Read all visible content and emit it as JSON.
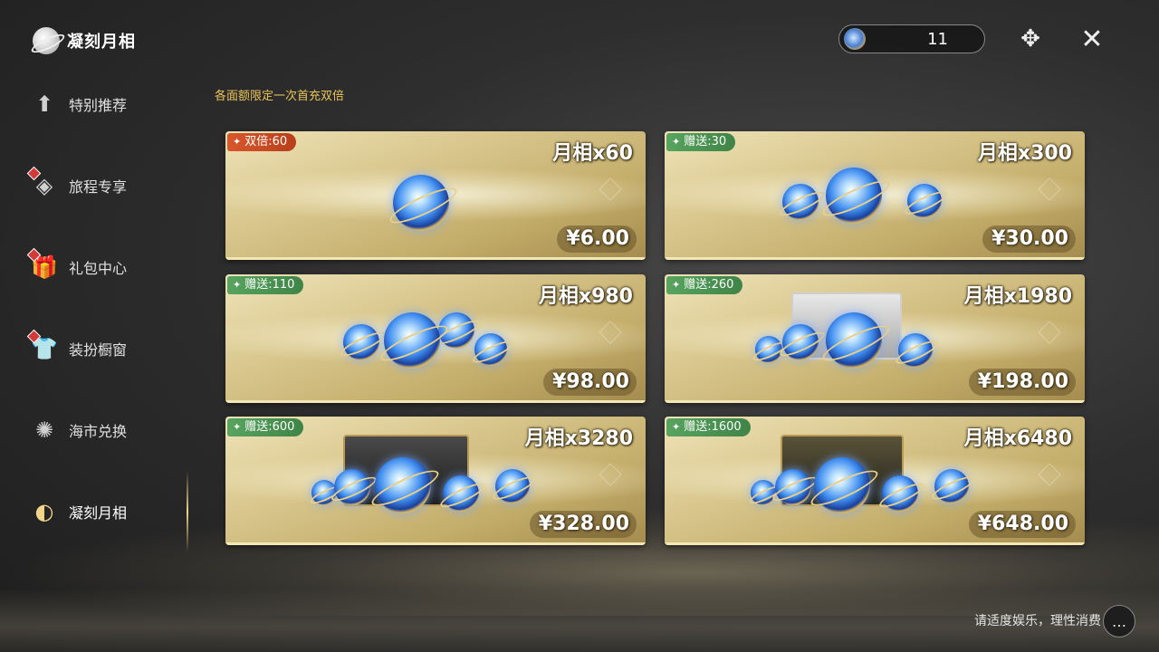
{
  "header": {
    "title": "凝刻月相",
    "currency_amount": "11"
  },
  "icons": {
    "close": "✕",
    "guide": "✥",
    "chat": "…"
  },
  "sidebar": {
    "items": [
      {
        "label": "特别推荐",
        "icon": "gift-arrow-icon",
        "glyph": "⬆",
        "badge": false
      },
      {
        "label": "旅程专享",
        "icon": "journey-icon",
        "glyph": "◈",
        "badge": true
      },
      {
        "label": "礼包中心",
        "icon": "gift-box-icon",
        "glyph": "🎁",
        "badge": true
      },
      {
        "label": "装扮橱窗",
        "icon": "outfit-icon",
        "glyph": "👕",
        "badge": true
      },
      {
        "label": "海市兑换",
        "icon": "coral-icon",
        "glyph": "✺",
        "badge": false
      },
      {
        "label": "凝刻月相",
        "icon": "moon-phase-icon",
        "glyph": "◐",
        "badge": false,
        "active": true
      }
    ]
  },
  "notice": "各面额限定一次首充双倍",
  "products": [
    {
      "badge": "双倍:60",
      "badge_type": "double",
      "title": "月相x60",
      "price": "¥6.00"
    },
    {
      "badge": "赠送:30",
      "badge_type": "gift",
      "title": "月相x300",
      "price": "¥30.00"
    },
    {
      "badge": "赠送:110",
      "badge_type": "gift",
      "title": "月相x980",
      "price": "¥98.00"
    },
    {
      "badge": "赠送:260",
      "badge_type": "gift",
      "title": "月相x1980",
      "price": "¥198.00"
    },
    {
      "badge": "赠送:600",
      "badge_type": "gift",
      "title": "月相x3280",
      "price": "¥328.00"
    },
    {
      "badge": "赠送:1600",
      "badge_type": "gift",
      "title": "月相x6480",
      "price": "¥648.00"
    }
  ],
  "footer": {
    "note": "请适度娱乐，理性消费"
  },
  "colors": {
    "accent_gold": "#e9c45a",
    "badge_double": "#d8572b",
    "badge_gift": "#58a45f"
  }
}
